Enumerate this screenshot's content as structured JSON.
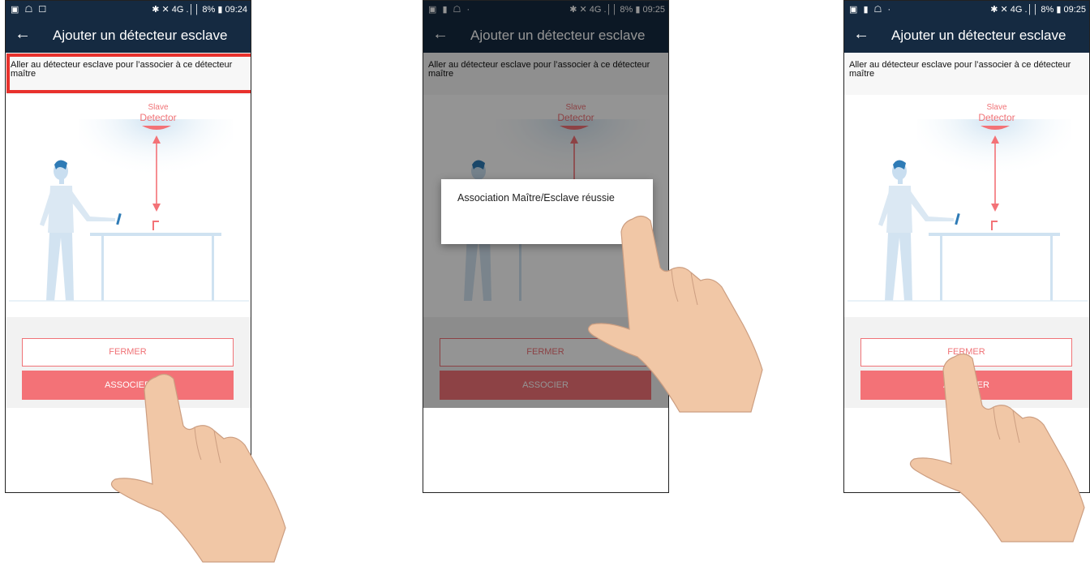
{
  "screens": [
    {
      "status": {
        "icons": "▣ ☖ ☐",
        "right": "✱ ✕ 4G .││ 8% ▮ 09:24"
      },
      "header": {
        "back_glyph": "←",
        "title": "Ajouter un détecteur esclave"
      },
      "instruction": "Aller au détecteur esclave pour l’associer à ce détecteur maître",
      "illustration": {
        "line1": "Slave",
        "line2": "Detector"
      },
      "buttons": {
        "close": "FERMER",
        "associate": "ASSOCIER"
      }
    },
    {
      "status": {
        "icons": "▣ ▮ ☖ ·",
        "right": "✱ ✕ 4G .││ 8% ▮ 09:25"
      },
      "header": {
        "back_glyph": "←",
        "title": "Ajouter un détecteur esclave"
      },
      "instruction": "Aller au détecteur esclave pour l’associer à ce détecteur maître",
      "illustration": {
        "line1": "Slave",
        "line2": "Detector"
      },
      "buttons": {
        "close": "FERMER",
        "associate": "ASSOCIER"
      },
      "dialog": {
        "message": "Association Maître/Esclave réussie",
        "ok": "OK"
      }
    },
    {
      "status": {
        "icons": "▣ ▮ ☖ ·",
        "right": "✱ ✕ 4G .││ 8% ▮ 09:25"
      },
      "header": {
        "back_glyph": "←",
        "title": "Ajouter un détecteur esclave"
      },
      "instruction": "Aller au détecteur esclave pour l’associer à ce détecteur maître",
      "illustration": {
        "line1": "Slave",
        "line2": "Detector"
      },
      "buttons": {
        "close": "FERMER",
        "associate": "ASSOCIER"
      }
    }
  ],
  "theme": {
    "header_bg": "#152a41",
    "accent": "#f37277",
    "highlight_frame": "#e8312c",
    "person_color": "#c9def0"
  }
}
